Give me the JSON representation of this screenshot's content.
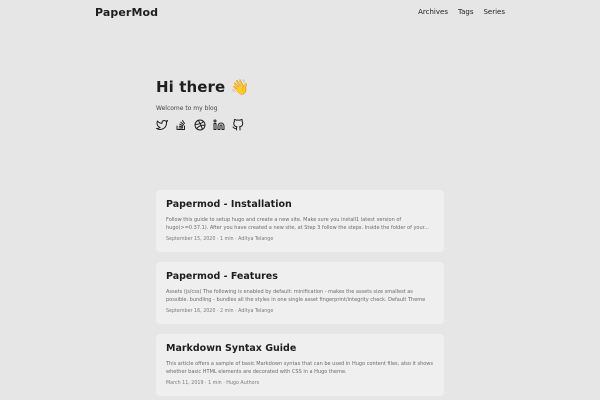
{
  "site": {
    "logo": "PaperMod",
    "menu": [
      "Archives",
      "Tags",
      "Series"
    ]
  },
  "home": {
    "title": "Hi there 👋",
    "subtitle": "Welcome to my blog",
    "social_icons": [
      "twitter-icon",
      "stackoverflow-icon",
      "dribbble-icon",
      "linkedin-icon",
      "github-icon"
    ]
  },
  "posts": [
    {
      "title": "Papermod - Installation",
      "summary": "Follow this guide to setup hugo and create a new site. Make sure you install1 latest version of hugo(>=0.37.1). After you have created a new site, at Step 3 follow the steps. Inside the folder of your...",
      "meta": "September 15, 2020 · 1 min · Aditya Telange"
    },
    {
      "title": "Papermod - Features",
      "summary": "Assets (js/css) The following is enabled by default: minification - makes the assets size smallest as possible. bundling - bundles all the styles in one single asset fingerprint/integrity check. Default Theme light/da...",
      "meta": "September 16, 2020 · 2 min · Aditya Telange"
    },
    {
      "title": "Markdown Syntax Guide",
      "summary": "This article offers a sample of basic Markdown syntax that can be used in Hugo content files, also it shows whether basic HTML elements are decorated with CSS in a Hugo theme.",
      "meta": "March 11, 2019 · 1 min · Hugo Authors"
    }
  ],
  "colors": {
    "background": "#e6e6e6",
    "card": "#efefef",
    "text": "#1e1e1e",
    "muted": "#6a6a6a"
  }
}
